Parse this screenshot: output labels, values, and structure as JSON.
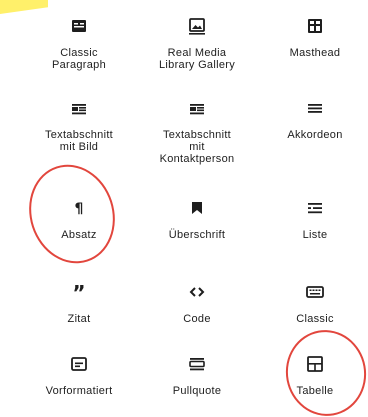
{
  "blocks": [
    {
      "label": "Classic\nParagraph",
      "icon": "classic-icon"
    },
    {
      "label": "Real Media\nLibrary Gallery",
      "icon": "gallery-icon"
    },
    {
      "label": "Masthead",
      "icon": "masthead-icon"
    },
    {
      "label": "Textabschnitt\nmit Bild",
      "icon": "media-text-icon"
    },
    {
      "label": "Textabschnitt\nmit\nKontaktperson",
      "icon": "media-text-icon"
    },
    {
      "label": "Akkordeon",
      "icon": "accordion-icon"
    },
    {
      "label": "Absatz",
      "icon": "paragraph-icon"
    },
    {
      "label": "Überschrift",
      "icon": "heading-icon"
    },
    {
      "label": "Liste",
      "icon": "list-icon"
    },
    {
      "label": "Zitat",
      "icon": "quote-icon"
    },
    {
      "label": "Code",
      "icon": "code-icon"
    },
    {
      "label": "Classic",
      "icon": "keyboard-icon"
    },
    {
      "label": "Vorformatiert",
      "icon": "preformatted-icon"
    },
    {
      "label": "Pullquote",
      "icon": "pullquote-icon"
    },
    {
      "label": "Tabelle",
      "icon": "table-icon"
    }
  ],
  "colors": {
    "text": "#1e1e1e",
    "annotation": "#e2463d",
    "highlight": "#fff06a"
  }
}
